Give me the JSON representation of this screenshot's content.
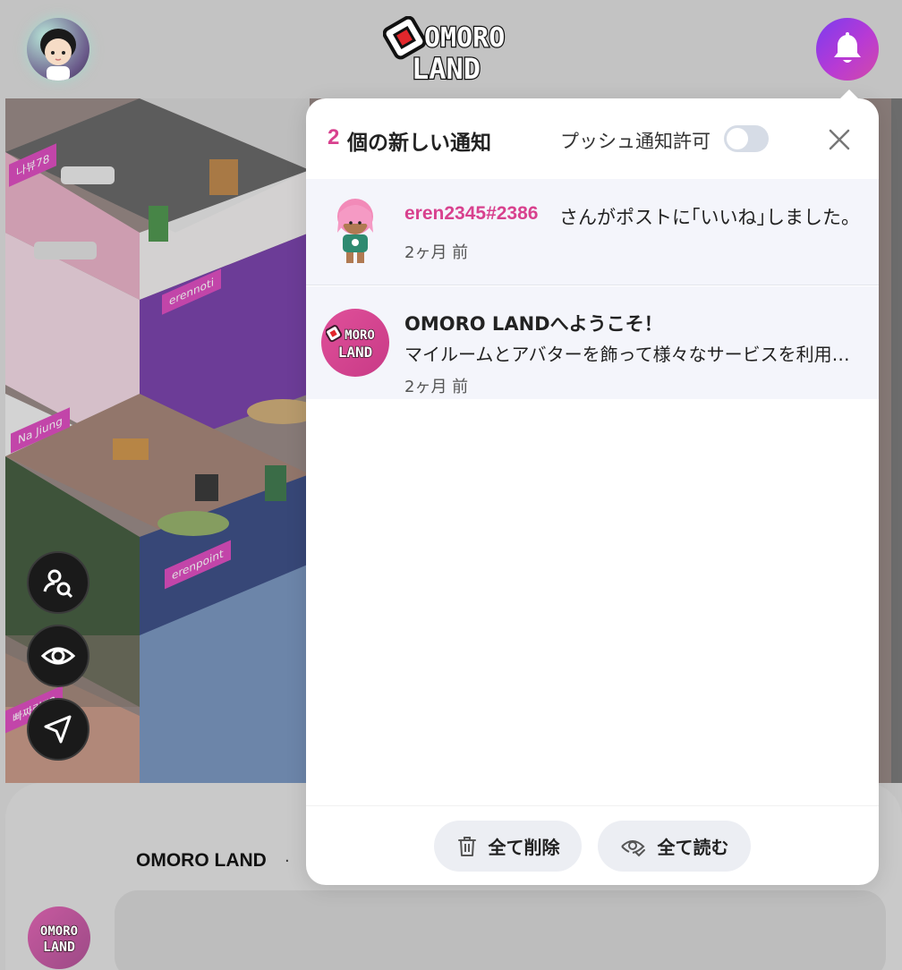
{
  "header": {
    "logo_line1": "OMORO",
    "logo_line2": "LAND",
    "brand_gradient": [
      "#7a3cf0",
      "#d24aa8"
    ]
  },
  "world": {
    "room_labels": [
      "나뷰78",
      "erennoti",
      "Na Jiung",
      "erenpoint",
      "빠짜린72"
    ]
  },
  "fabs": [
    "user-search-icon",
    "eye-icon",
    "navigate-icon"
  ],
  "notifications": {
    "count": "2",
    "title": "個の新しい通知",
    "push_label": "プッシュ通知許可",
    "push_enabled": false,
    "items": [
      {
        "user": "eren2345#2386",
        "message": "さんがポストに｢いいね｣しました。",
        "time": "2ヶ月 前",
        "avatar": "pink-haired-avatar"
      },
      {
        "title": "OMORO LANDへようこそ！",
        "body": "マイルームとアバターを飾って様々なサービスを利用してみましょう",
        "time": "2ヶ月 前",
        "avatar": "omoro-land-logo"
      }
    ],
    "delete_all_label": "全て削除",
    "read_all_label": "全て読む"
  },
  "sheet": {
    "title": "OMORO LAND",
    "separator": "·"
  },
  "colors": {
    "accent_pink": "#d8418e",
    "panel_bg": "#ffffff",
    "item_bg": "#f4f5fb"
  }
}
